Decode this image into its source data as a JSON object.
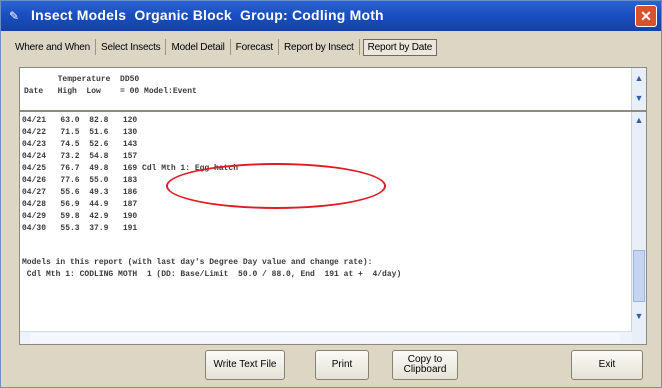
{
  "window": {
    "title": "Insect Models  Organic Block  Group: Codling Moth",
    "close_glyph": "✕",
    "app_icon_glyph": "✎"
  },
  "tabs": [
    {
      "label": "Where and When",
      "active": false
    },
    {
      "label": "Select Insects",
      "active": false
    },
    {
      "label": "Model Detail",
      "active": false
    },
    {
      "label": "Forecast",
      "active": false
    },
    {
      "label": "Report by Insect",
      "active": false
    },
    {
      "label": "Report by Date",
      "active": true
    }
  ],
  "report_header": {
    "line1": "       Temperature  DD50",
    "line2": "Date   High  Low    = 00 Model:Event"
  },
  "report_rows": [
    "04/21   63.0  82.8   120",
    "04/22   71.5  51.6   130",
    "04/23   74.5  52.6   143",
    "04/24   73.2  54.8   157",
    "04/25   76.7  49.8   169 Cdl Mth 1: Egg hatch",
    "04/26   77.6  55.0   183",
    "04/27   55.6  49.3   186",
    "04/28   56.9  44.9   187",
    "04/29   59.8  42.9   190",
    "04/30   55.3  37.9   191",
    "",
    "Models in this report (with last day's Degree Day value and change rate):",
    " Cdl Mth 1: CODLING MOTH  1 (DD: Base/Limit  50.0 / 88.0, End  191 at +  4/day)"
  ],
  "buttons": {
    "write_text_file": "Write Text File",
    "print": "Print",
    "copy_line1": "Copy to",
    "copy_line2": "Clipboard",
    "exit": "Exit"
  },
  "icons": {
    "scroll_up": "up-arrow-icon",
    "scroll_down": "down-arrow-icon"
  },
  "colors": {
    "titlebar": "#1a4fc0",
    "highlight": "#e01b24",
    "dialog_bg": "#dcd7c5"
  }
}
